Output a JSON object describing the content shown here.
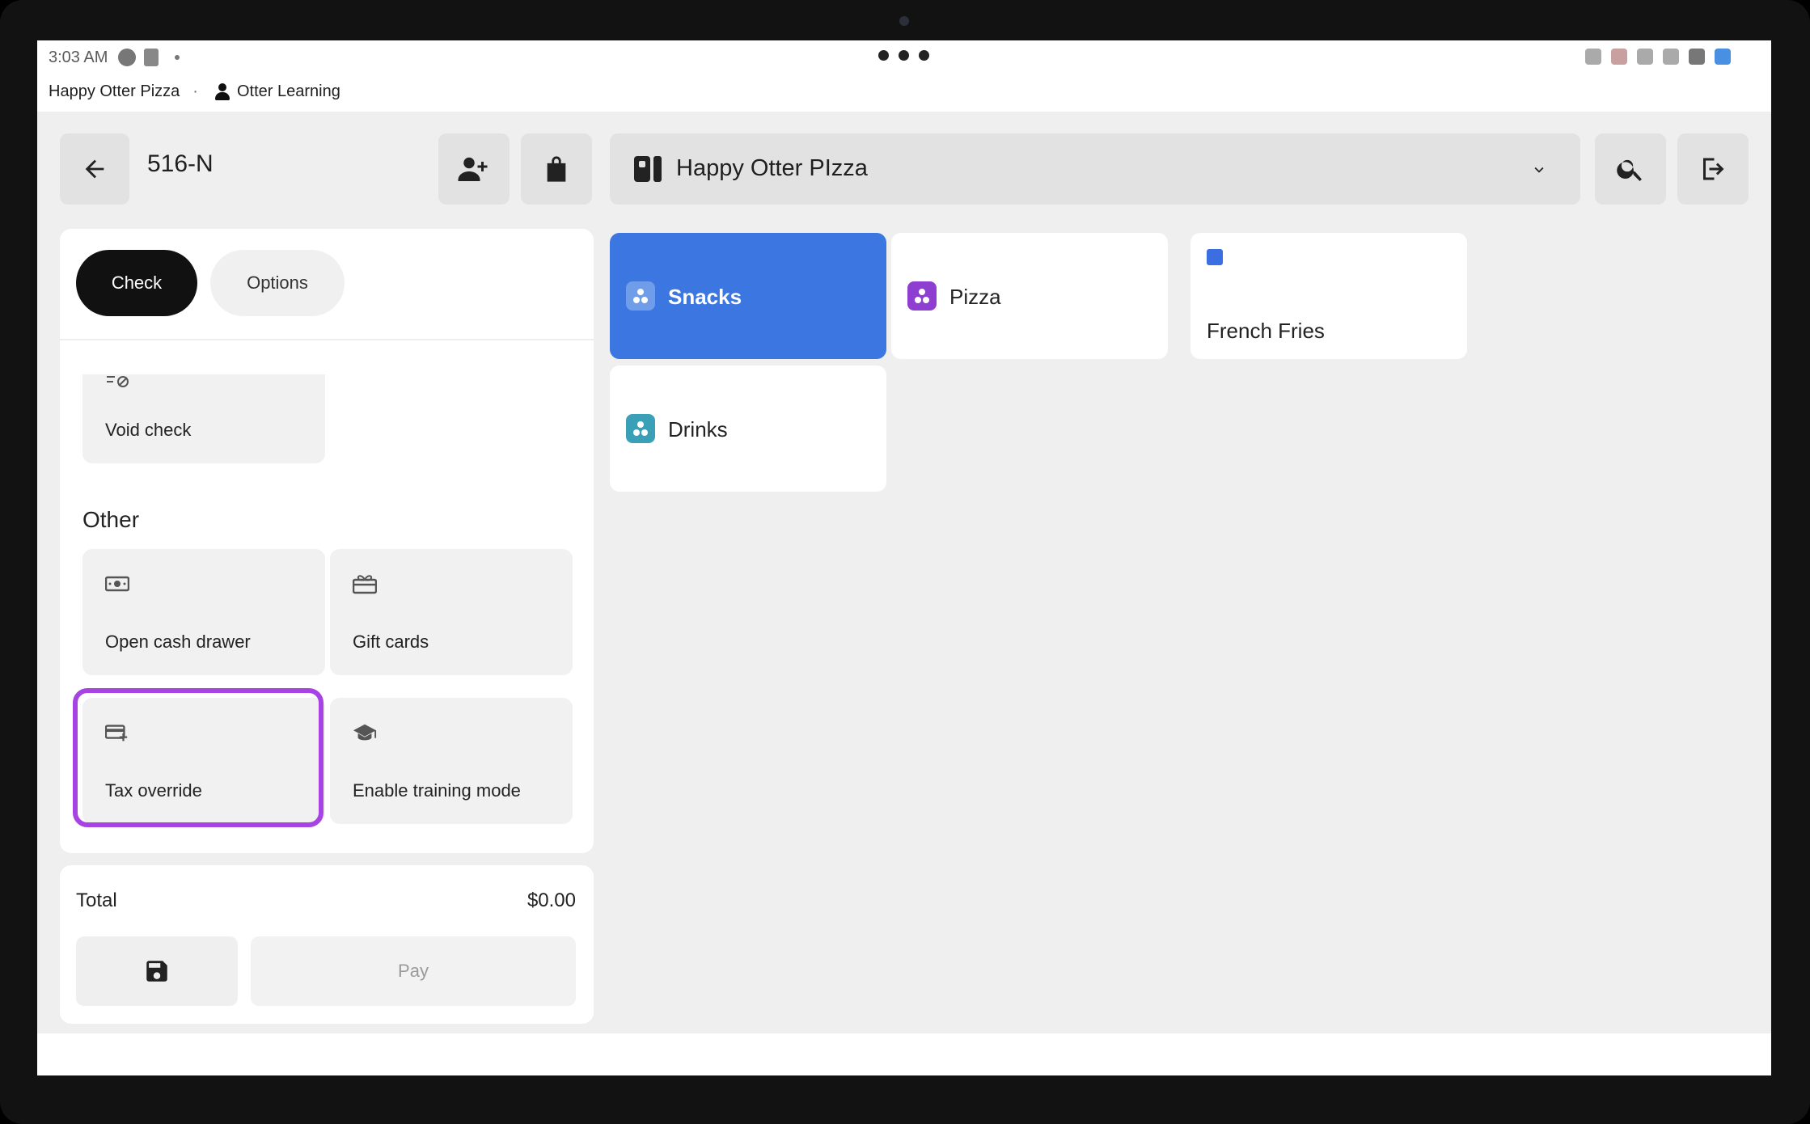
{
  "status_bar": {
    "time": "3:03 AM"
  },
  "org_bar": {
    "restaurant": "Happy Otter Pizza",
    "separator": "·",
    "user": "Otter Learning"
  },
  "header": {
    "order_number": "516-N",
    "location_name": "Happy Otter PIzza"
  },
  "tabs": {
    "check": "Check",
    "options": "Options"
  },
  "options": {
    "void_check": "Void check",
    "other_title": "Other",
    "open_cash_drawer": "Open cash drawer",
    "gift_cards": "Gift cards",
    "tax_override": "Tax override",
    "enable_training_mode": "Enable training mode"
  },
  "totals": {
    "label": "Total",
    "amount": "$0.00",
    "pay_label": "Pay"
  },
  "categories": [
    {
      "name": "Snacks",
      "color": "#6f9de9",
      "active": true
    },
    {
      "name": "Pizza",
      "color": "#8e3fd1"
    },
    {
      "name": "French Fries",
      "color": "#3b6ee0"
    },
    {
      "name": "Drinks",
      "color": "#3aa0b8"
    }
  ],
  "colors": {
    "accent_blue": "#3b76e1",
    "highlight_purple": "#a743e3",
    "tab_active": "#111111"
  }
}
